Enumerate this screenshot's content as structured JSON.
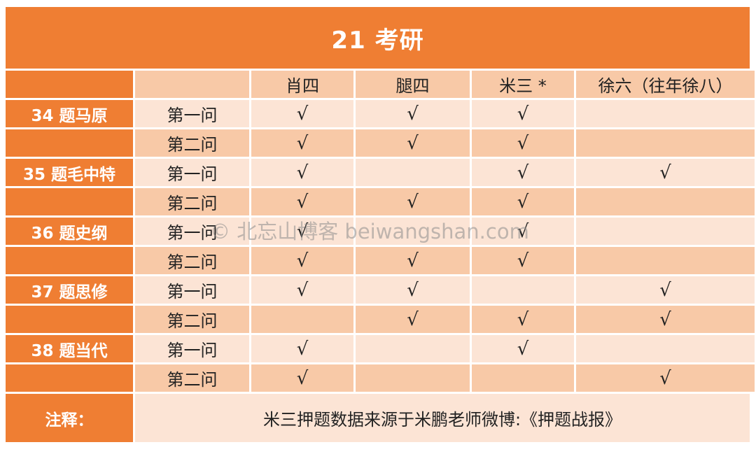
{
  "title": "21 考研",
  "header": {
    "corner": "",
    "sub": "",
    "columns": [
      "肖四",
      "腿四",
      "米三 *",
      "徐六（往年徐八）"
    ]
  },
  "rows": [
    {
      "topic": "34 题马原",
      "question": "第一问",
      "marks": [
        "√",
        "√",
        "√",
        ""
      ]
    },
    {
      "topic": "",
      "question": "第二问",
      "marks": [
        "√",
        "√",
        "√",
        ""
      ]
    },
    {
      "topic": "35 题毛中特",
      "question": "第一问",
      "marks": [
        "√",
        "",
        "√",
        "√"
      ]
    },
    {
      "topic": "",
      "question": "第二问",
      "marks": [
        "√",
        "√",
        "√",
        ""
      ]
    },
    {
      "topic": "36 题史纲",
      "question": "第一问",
      "marks": [
        "√",
        "",
        "√",
        ""
      ]
    },
    {
      "topic": "",
      "question": "第二问",
      "marks": [
        "√",
        "√",
        "√",
        ""
      ]
    },
    {
      "topic": "37 题思修",
      "question": "第一问",
      "marks": [
        "√",
        "√",
        "",
        "√"
      ]
    },
    {
      "topic": "",
      "question": "第二问",
      "marks": [
        "",
        "√",
        "√",
        "√"
      ]
    },
    {
      "topic": "38 题当代",
      "question": "第一问",
      "marks": [
        "√",
        "",
        "√",
        ""
      ]
    },
    {
      "topic": "",
      "question": "第二问",
      "marks": [
        "√",
        "",
        "",
        "√"
      ]
    }
  ],
  "note": {
    "label": "注释：",
    "text": "米三押题数据来源于米鹏老师微博:《押题战报》"
  },
  "watermark": "© 北忘山博客 beiwangshan.com",
  "colors": {
    "accent": "#ef7e33",
    "mid": "#f8c9a7",
    "light": "#fce4d5"
  }
}
